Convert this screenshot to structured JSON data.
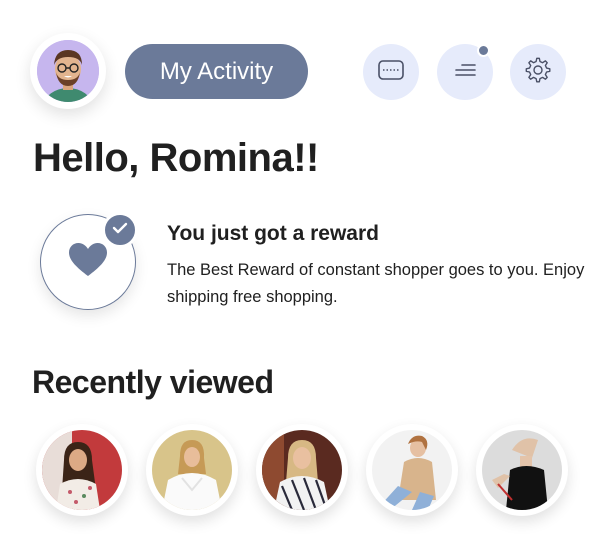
{
  "header": {
    "avatar_alt": "profile photo",
    "activity_label": "My Activity",
    "icons": [
      "voucher-icon",
      "menu-icon",
      "settings-icon"
    ],
    "has_notification": true
  },
  "greeting": "Hello, Romina!!",
  "reward": {
    "title": "You just got a reward",
    "description": "The Best Reward of constant shopper goes to you. Enjoy shipping free shopping."
  },
  "recently_viewed": {
    "title": "Recently viewed",
    "items": [
      {
        "name": "floral-blouse-item"
      },
      {
        "name": "white-sweater-item"
      },
      {
        "name": "striped-shirt-item"
      },
      {
        "name": "beige-knit-item"
      },
      {
        "name": "black-top-item"
      }
    ]
  },
  "colors": {
    "accent": "#6b7a99",
    "icon_bg": "#e6ebfb",
    "text": "#202020"
  }
}
